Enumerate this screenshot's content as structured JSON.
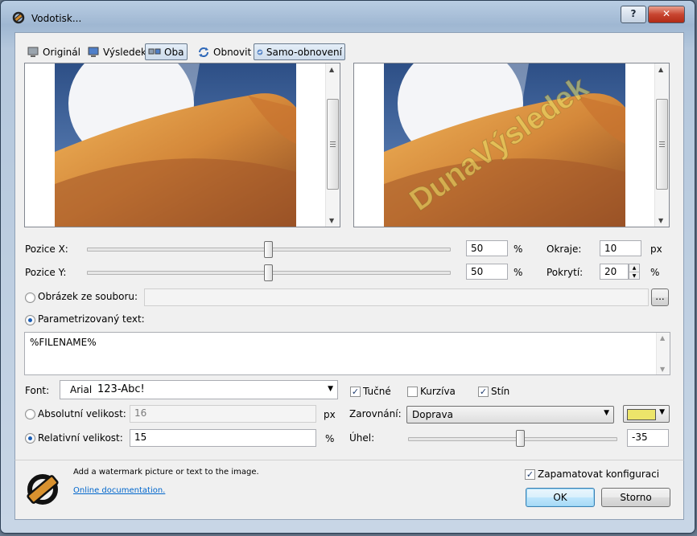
{
  "window": {
    "title": "Vodotisk...",
    "help_label": "?",
    "close_label": "✕"
  },
  "toolbar": {
    "original_label": "Originál",
    "result_label": "Výsledek",
    "both_label": "Oba",
    "refresh_label": "Obnovit",
    "auto_refresh_label": "Samo-obnovení"
  },
  "preview": {
    "watermark_text": "DunaVýsledek"
  },
  "position": {
    "x_label": "Pozice X:",
    "x_value": "50",
    "x_unit": "%",
    "x_slider_fraction": 0.5,
    "y_label": "Pozice Y:",
    "y_value": "50",
    "y_unit": "%",
    "y_slider_fraction": 0.5
  },
  "margins": {
    "label": "Okraje:",
    "value": "10",
    "unit": "px"
  },
  "coverage": {
    "label": "Pokrytí:",
    "value": "20",
    "unit": "%"
  },
  "image_source": {
    "label": "Obrázek ze souboru:",
    "value": "",
    "browse_label": "..."
  },
  "text_source": {
    "label": "Parametrizovaný text:",
    "value": "%FILENAME%"
  },
  "font": {
    "label": "Font:",
    "name": "Arial",
    "sample": "123-Abc!"
  },
  "style": {
    "bold_label": "Tučné",
    "bold": true,
    "italic_label": "Kurzíva",
    "italic": false,
    "shadow_label": "Stín",
    "shadow": true
  },
  "abs_size": {
    "label": "Absolutní velikost:",
    "value": "16",
    "unit": "px"
  },
  "rel_size": {
    "label": "Relativní velikost:",
    "value": "15",
    "unit": "%"
  },
  "alignment": {
    "label": "Zarovnání:",
    "value": "Doprava"
  },
  "color": {
    "swatch": "#ece56a"
  },
  "angle": {
    "label": "Úhel:",
    "value": "-35",
    "slider_fraction": 0.54
  },
  "footer": {
    "description": "Add a watermark picture or text to the image.",
    "docs_link": "Online documentation.",
    "remember_label": "Zapamatovat konfiguraci",
    "remember": true,
    "ok_label": "OK",
    "cancel_label": "Storno"
  }
}
